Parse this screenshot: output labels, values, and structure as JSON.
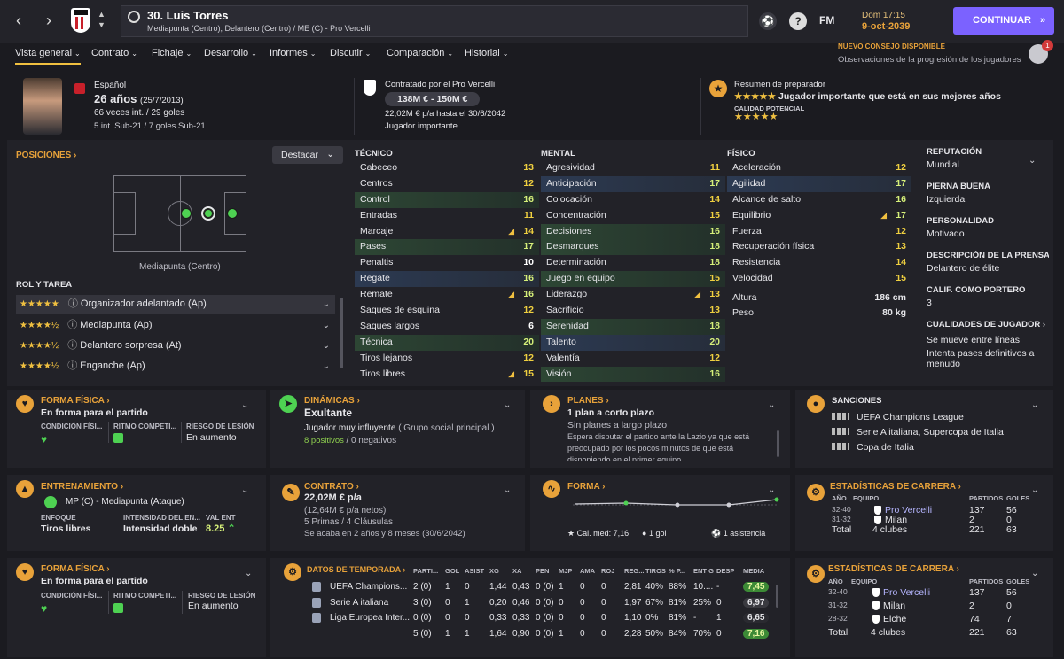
{
  "topbar": {
    "player_title": "30. Luis Torres",
    "player_subtitle": "Mediapunta (Centro), Delantero (Centro) / ME (C) - Pro Vercelli",
    "date_day": "Dom 17:15",
    "date": "9-oct-2039",
    "fm_label": "FM",
    "continue_label": "CONTINUAR",
    "notification_title": "NUEVO CONSEJO DISPONIBLE",
    "notification_text": "Observaciones de la progresión de los jugadores",
    "notification_count": "1"
  },
  "tabs": [
    {
      "label": "Vista general"
    },
    {
      "label": "Contrato"
    },
    {
      "label": "Fichaje"
    },
    {
      "label": "Desarrollo"
    },
    {
      "label": "Informes"
    },
    {
      "label": "Discutir"
    },
    {
      "label": "Comparación"
    },
    {
      "label": "Historial"
    }
  ],
  "header": {
    "nationality": "Español",
    "age": "26 años",
    "dob": "(25/7/2013)",
    "caps": "66 veces int. / 29 goles",
    "u21": "5 int. Sub-21 / 7 goles Sub-21",
    "contract_title": "Contratado por el Pro Vercelli",
    "value": "138M € - 150M €",
    "wage": "22,02M € p/a hasta el 30/6/2042",
    "status": "Jugador importante",
    "coach_title": "Resumen de preparador",
    "coach_text": "Jugador importante que está en sus mejores años",
    "potential_label": "CALIDAD POTENCIAL",
    "current_stars": "★★★★★",
    "potential_stars": "★★★★★"
  },
  "positions": {
    "title": "POSICIONES",
    "highlight_label": "Destacar",
    "position_name": "Mediapunta (Centro)",
    "role_title": "ROL Y TAREA",
    "roles": [
      {
        "stars": "★★★★★",
        "name": "Organizador adelantado (Ap)"
      },
      {
        "stars": "★★★★½",
        "name": "Mediapunta (Ap)"
      },
      {
        "stars": "★★★★½",
        "name": "Delantero sorpresa (At)"
      },
      {
        "stars": "★★★★½",
        "name": "Enganche (Ap)"
      }
    ]
  },
  "attributes": {
    "tecnico_title": "TÉCNICO",
    "mental_title": "MENTAL",
    "fisico_title": "FÍSICO",
    "tecnico": [
      {
        "name": "Cabeceo",
        "value": "13",
        "hl": "",
        "arrow": "",
        "color": "vyel"
      },
      {
        "name": "Centros",
        "value": "12",
        "hl": "",
        "arrow": "",
        "color": "vyel"
      },
      {
        "name": "Control",
        "value": "16",
        "hl": "hl-green",
        "arrow": "",
        "color": "vgreen"
      },
      {
        "name": "Entradas",
        "value": "11",
        "hl": "",
        "arrow": "",
        "color": "vyel"
      },
      {
        "name": "Marcaje",
        "value": "14",
        "hl": "",
        "arrow": "◢",
        "color": "vyel"
      },
      {
        "name": "Pases",
        "value": "17",
        "hl": "hl-green",
        "arrow": "",
        "color": "vgreen"
      },
      {
        "name": "Penaltis",
        "value": "10",
        "hl": "",
        "arrow": "",
        "color": "vwhite"
      },
      {
        "name": "Regate",
        "value": "16",
        "hl": "hl-blue",
        "arrow": "",
        "color": "vgreen"
      },
      {
        "name": "Remate",
        "value": "16",
        "hl": "",
        "arrow": "◢",
        "color": "vgreen"
      },
      {
        "name": "Saques de esquina",
        "value": "12",
        "hl": "",
        "arrow": "",
        "color": "vyel"
      },
      {
        "name": "Saques largos",
        "value": "6",
        "hl": "",
        "arrow": "",
        "color": "vwhite"
      },
      {
        "name": "Técnica",
        "value": "20",
        "hl": "hl-green",
        "arrow": "",
        "color": "vgreen"
      },
      {
        "name": "Tiros lejanos",
        "value": "12",
        "hl": "",
        "arrow": "",
        "color": "vyel"
      },
      {
        "name": "Tiros libres",
        "value": "15",
        "hl": "",
        "arrow": "◢",
        "color": "vyel"
      }
    ],
    "mental": [
      {
        "name": "Agresividad",
        "value": "11",
        "hl": "",
        "arrow": "",
        "color": "vyel"
      },
      {
        "name": "Anticipación",
        "value": "17",
        "hl": "hl-blue",
        "arrow": "",
        "color": "vgreen"
      },
      {
        "name": "Colocación",
        "value": "14",
        "hl": "",
        "arrow": "",
        "color": "vyel"
      },
      {
        "name": "Concentración",
        "value": "15",
        "hl": "",
        "arrow": "",
        "color": "vyel"
      },
      {
        "name": "Decisiones",
        "value": "16",
        "hl": "hl-green",
        "arrow": "",
        "color": "vgreen"
      },
      {
        "name": "Desmarques",
        "value": "18",
        "hl": "hl-green",
        "arrow": "",
        "color": "vgreen"
      },
      {
        "name": "Determinación",
        "value": "18",
        "hl": "",
        "arrow": "",
        "color": "vgreen"
      },
      {
        "name": "Juego en equipo",
        "value": "15",
        "hl": "hl-green",
        "arrow": "",
        "color": "vyel"
      },
      {
        "name": "Liderazgo",
        "value": "13",
        "hl": "",
        "arrow": "◢",
        "color": "vyel"
      },
      {
        "name": "Sacrificio",
        "value": "13",
        "hl": "",
        "arrow": "",
        "color": "vyel"
      },
      {
        "name": "Serenidad",
        "value": "18",
        "hl": "hl-green",
        "arrow": "",
        "color": "vgreen"
      },
      {
        "name": "Talento",
        "value": "20",
        "hl": "hl-blue",
        "arrow": "",
        "color": "vgreen"
      },
      {
        "name": "Valentía",
        "value": "12",
        "hl": "",
        "arrow": "",
        "color": "vyel"
      },
      {
        "name": "Visión",
        "value": "16",
        "hl": "hl-green",
        "arrow": "",
        "color": "vgreen"
      }
    ],
    "fisico": [
      {
        "name": "Aceleración",
        "value": "12",
        "hl": "",
        "arrow": "",
        "color": "vyel"
      },
      {
        "name": "Agilidad",
        "value": "17",
        "hl": "hl-blue",
        "arrow": "",
        "color": "vgreen"
      },
      {
        "name": "Alcance de salto",
        "value": "16",
        "hl": "",
        "arrow": "",
        "color": "vgreen"
      },
      {
        "name": "Equilibrio",
        "value": "17",
        "hl": "",
        "arrow": "◢",
        "color": "vgreen"
      },
      {
        "name": "Fuerza",
        "value": "12",
        "hl": "",
        "arrow": "",
        "color": "vyel"
      },
      {
        "name": "Recuperación física",
        "value": "13",
        "hl": "",
        "arrow": "",
        "color": "vyel"
      },
      {
        "name": "Resistencia",
        "value": "14",
        "hl": "",
        "arrow": "",
        "color": "vyel"
      },
      {
        "name": "Velocidad",
        "value": "15",
        "hl": "",
        "arrow": "",
        "color": "vyel"
      }
    ],
    "height_label": "Altura",
    "height": "186 cm",
    "weight_label": "Peso",
    "weight": "80 kg"
  },
  "profile": {
    "rep_title": "REPUTACIÓN",
    "rep": "Mundial",
    "foot_title": "PIERNA BUENA",
    "foot": "Izquierda",
    "pers_title": "PERSONALIDAD",
    "pers": "Motivado",
    "desc_title": "DESCRIPCIÓN DE LA PRENSA",
    "desc": "Delantero de élite",
    "gk_title": "CALIF. COMO PORTERO",
    "gk": "3",
    "qual_title": "CUALIDADES DE JUGADOR",
    "qual1": "Se mueve entre líneas",
    "qual2": "Intenta pases definitivos a menudo"
  },
  "cards": {
    "forma1": {
      "title": "FORMA FÍSICA",
      "value": "En forma para el partido",
      "c1": "CONDICIÓN FÍSI...",
      "c2": "RITMO COMPETI...",
      "c3": "RIESGO DE LESIÓN",
      "c3v": "En aumento"
    },
    "dinamicas": {
      "title": "DINÁMICAS",
      "value": "Exultante",
      "line1": "Jugador muy influyente",
      "line1b": "( Grupo social principal )",
      "pos": "8 positivos",
      "neg": "0 negativos"
    },
    "planes": {
      "title": "PLANES",
      "value": "1 plan a corto plazo",
      "sub": "Sin planes a largo plazo",
      "text": "Espera disputar el partido ante la Lazio ya que está preocupado por los pocos minutos de que está disponiendo en el primer equipo"
    },
    "sanciones": {
      "title": "SANCIONES",
      "items": [
        "UEFA Champions League",
        "Serie A italiana, Supercopa de Italia",
        "Copa de Italia"
      ]
    },
    "entrenamiento": {
      "title": "ENTRENAMIENTO",
      "value": "MP (C) - Mediapunta (Ataque)",
      "h1": "ENFOQUE",
      "v1": "Tiros libres",
      "h2": "INTENSIDAD DEL EN...",
      "v2": "Intensidad doble",
      "h3": "VAL ENT",
      "v3": "8.25"
    },
    "contrato": {
      "title": "CONTRATO",
      "value": "22,02M € p/a",
      "l1": "(12,64M € p/a netos)",
      "l2": "5 Primas / 4 Cláusulas",
      "l3": "Se acaba en 2 años y 8 meses (30/6/2042)"
    },
    "forma": {
      "title": "FORMA",
      "avg": "Cal. med: 7,16",
      "goals": "1 gol",
      "assists": "1 asistencia"
    },
    "carrera1": {
      "title": "ESTADÍSTICAS DE CARRERA",
      "h_year": "AÑO",
      "h_team": "EQUIPO",
      "h_apps": "PARTIDOS",
      "h_goals": "GOLES",
      "rows": [
        {
          "year": "32-40",
          "team": "Pro Vercelli",
          "apps": "137",
          "goals": "56"
        },
        {
          "year": "31-32",
          "team": "Milan",
          "apps": "2",
          "goals": "0"
        }
      ],
      "total": "Total",
      "total_team": "4 clubes",
      "total_apps": "221",
      "total_goals": "63"
    },
    "forma2": {
      "title": "FORMA FÍSICA",
      "value": "En forma para el partido",
      "c1": "CONDICIÓN FÍSI...",
      "c2": "RITMO COMPETI...",
      "c3": "RIESGO DE LESIÓN",
      "c3v": "En aumento"
    },
    "temporada": {
      "title": "DATOS DE TEMPORADA",
      "headers": [
        "PARTI...",
        "GOL",
        "ASIST",
        "XG",
        "XA",
        "PEN",
        "MJP",
        "AMA",
        "ROJ",
        "REG...",
        "TIROS",
        "% P...",
        "ENT G",
        "DESP",
        "MEDIA"
      ],
      "rows": [
        {
          "comp": "UEFA Champions...",
          "cells": [
            "2 (0)",
            "1",
            "0",
            "1,44",
            "0,43",
            "0 (0)",
            "1",
            "0",
            "0",
            "2,81",
            "40%",
            "88%",
            "10....",
            "-",
            "7,45"
          ],
          "mc": "#3c8a36"
        },
        {
          "comp": "Serie A italiana",
          "cells": [
            "3 (0)",
            "0",
            "1",
            "0,20",
            "0,46",
            "0 (0)",
            "0",
            "0",
            "0",
            "1,97",
            "67%",
            "81%",
            "25%",
            "0",
            "6,97"
          ],
          "mc": "#3a3a40"
        },
        {
          "comp": "Liga Europea Inter...",
          "cells": [
            "0 (0)",
            "0",
            "0",
            "0,33",
            "0,33",
            "0 (0)",
            "0",
            "0",
            "0",
            "1,10",
            "0%",
            "81%",
            "-",
            "1",
            "6,65"
          ],
          "mc": "#2a2a30"
        },
        {
          "comp": "",
          "cells": [
            "5 (0)",
            "1",
            "1",
            "1,64",
            "0,90",
            "0 (0)",
            "1",
            "0",
            "0",
            "2,28",
            "50%",
            "84%",
            "70%",
            "0",
            "7,16"
          ],
          "mc": "#3c8a36"
        }
      ]
    },
    "carrera2": {
      "title": "ESTADÍSTICAS DE CARRERA",
      "h_year": "AÑO",
      "h_team": "EQUIPO",
      "h_apps": "PARTIDOS",
      "h_goals": "GOLES",
      "rows": [
        {
          "year": "32-40",
          "team": "Pro Vercelli",
          "apps": "137",
          "goals": "56"
        },
        {
          "year": "31-32",
          "team": "Milan",
          "apps": "2",
          "goals": "0"
        },
        {
          "year": "28-32",
          "team": "Elche",
          "apps": "74",
          "goals": "7"
        }
      ],
      "total": "Total",
      "total_team": "4 clubes",
      "total_apps": "221",
      "total_goals": "63"
    }
  },
  "colors": {
    "accent": "#e8a23a",
    "primary": "#7b62ff",
    "good": "#d6f07a",
    "average": "#f0d040"
  }
}
